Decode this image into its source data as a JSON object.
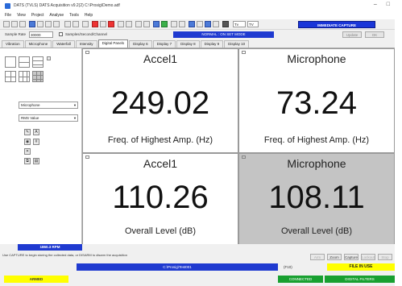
{
  "window": {
    "title": "DATS (TVLS) DATS Acquisition v9.2(2) C:\\Prosig\\Demo.adf",
    "controls": [
      "–",
      "□"
    ]
  },
  "menu": [
    "File",
    "View",
    "Project",
    "Analyse",
    "Tools",
    "Help"
  ],
  "toolbar": {
    "field1": "Tv",
    "field2": "TV",
    "capture_label": "IMMEDIATE CAPTURE"
  },
  "samplebar": {
    "rate_label": "Sample Rate",
    "rate_value": "30000",
    "checkbox_label": "Samples/Second/Channel",
    "status_field": "NORMAL : ON SET MODE",
    "btn1": "Update",
    "btn2": "OK"
  },
  "tabs": [
    "Vibration",
    "Microphone",
    "Waterfall",
    "Intensity",
    "Digital Panels",
    "Display 6",
    "Display 7",
    "Display 8",
    "Display 9",
    "Display 10"
  ],
  "active_tab": 4,
  "leftpanel": {
    "select1": "Microphone",
    "select2": "RMS Value"
  },
  "tiles": [
    {
      "name": "Accel1",
      "value": "249.02",
      "unit": "Freq. of Highest Amp. (Hz)"
    },
    {
      "name": "Microphone",
      "value": "73.24",
      "unit": "Freq. of Highest Amp. (Hz)"
    },
    {
      "name": "Accel1",
      "value": "110.26",
      "unit": "Overall Level (dB)"
    },
    {
      "name": "Microphone",
      "value": "108.11",
      "unit": "Overall Level (dB)"
    }
  ],
  "rpm": "1860.3 RPM",
  "hint": "Use CAPTURE to begin storing the collected data, or DISARM to disarm the acquisition",
  "hint_buttons": [
    "Arm",
    "Zoom",
    "Capture",
    "Lockout",
    "Stop"
  ],
  "path": "C:\\Prosig\\Test001",
  "fkey": "(F10)",
  "file_in_use": "FILE IN USE",
  "status": {
    "armed": "ARMED",
    "connected": "CONNECTED",
    "filter": "DIGITAL FILTERS"
  },
  "colors": {
    "accent_blue": "#1f3ad0",
    "highlight_yellow": "#ffff00",
    "status_green": "#18a030",
    "tile_grey": "#c4c4c4"
  }
}
